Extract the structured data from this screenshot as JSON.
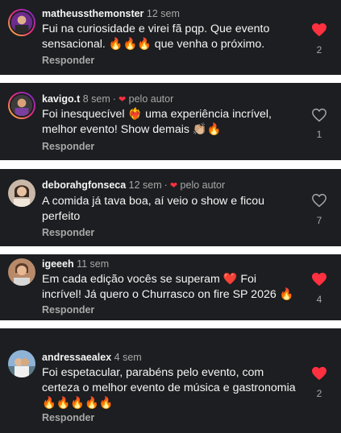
{
  "comments": [
    {
      "username": "matheussthemonster",
      "time": "12 sem",
      "author_badge": "",
      "text": "Fui na curiosidade e virei fã pqp. Que evento sensacional. 🔥🔥🔥 que venha o próximo.",
      "reply_label": "Responder",
      "likes": "2",
      "liked": true,
      "avatar_icon": "avatar-photo-ring"
    },
    {
      "username": "kavigo.t",
      "time": "8 sem",
      "author_badge": "pelo autor",
      "text": "Foi inesquecível ❤️‍🔥 uma experiência incrível, melhor evento! Show demais 👏🏼🔥",
      "reply_label": "Responder",
      "likes": "1",
      "liked": false,
      "avatar_icon": "avatar-photo-ring"
    },
    {
      "username": "deborahgfonseca",
      "time": "12 sem",
      "author_badge": "pelo autor",
      "text": "A comida já tava boa, aí veio o show e ficou perfeito",
      "reply_label": "Responder",
      "likes": "7",
      "liked": false,
      "avatar_icon": "avatar-photo"
    },
    {
      "username": "igeeeh",
      "time": "11 sem",
      "author_badge": "",
      "text": "Em cada edição vocês se superam ❤️ Foi incrível! Já quero o Churrasco on fire SP 2026 🔥",
      "reply_label": "Responder",
      "likes": "4",
      "liked": true,
      "avatar_icon": "avatar-photo"
    },
    {
      "username": "andressaealex",
      "time": "4 sem",
      "author_badge": "",
      "text": "Foi espetacular, parabéns  pelo evento, com certeza o melhor evento de música e gastronomia 🔥🔥🔥🔥🔥",
      "reply_label": "Responder",
      "likes": "2",
      "liked": true,
      "avatar_icon": "avatar-photo"
    }
  ],
  "colors": {
    "card_bg": "#1c1e21",
    "liked_heart": "#ff3040",
    "muted": "#a8a8a8",
    "text": "#f5f5f5"
  }
}
